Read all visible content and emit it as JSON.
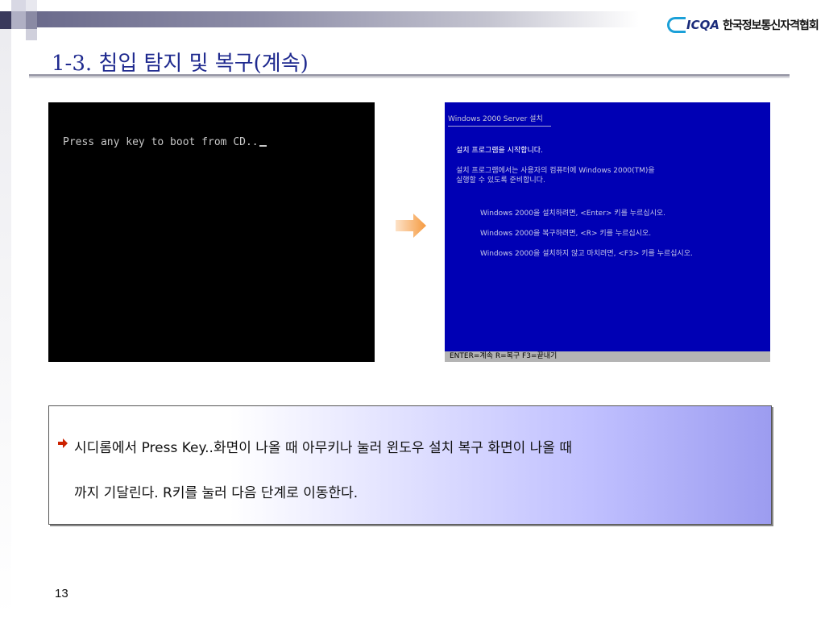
{
  "header": {
    "logo_mark": "ICQA",
    "logo_text": "한국정보통신자격협회"
  },
  "slide": {
    "title": "1-3. 침입 탐지 및 복구(계속)",
    "page_number": "13"
  },
  "boot_screen": {
    "text": "Press any key to boot from CD.."
  },
  "setup_screen": {
    "header": "Windows 2000 Server 설치",
    "line1": "설치 프로그램을 시작합니다.",
    "line2a": "설치 프로그램에서는 사용자의 컴퓨터에 Windows 2000(TM)을",
    "line2b": "실행할 수 있도록 준비합니다.",
    "option1": "Windows 2000을 설치하려면, <Enter> 키를 누르십시오.",
    "option2": "Windows 2000을 복구하려면, <R> 키를 누르십시오.",
    "option3": "Windows 2000을 설치하지 않고 마치려면, <F3> 키를 누르십시오.",
    "status_bar": "ENTER=계속  R=복구  F3=끝내기"
  },
  "note": {
    "line1": "시디롬에서 Press Key..화면이 나올 때 아무키나 눌러 윈도우 설치 복구 화면이 나올 때",
    "line2": "까지 기달린다. R키를 눌러 다음 단계로 이동한다."
  },
  "colors": {
    "title": "#1f2a8f",
    "setup_bg": "#0000b4",
    "arrow": "#f5a050",
    "bullet": "#cc2200"
  }
}
